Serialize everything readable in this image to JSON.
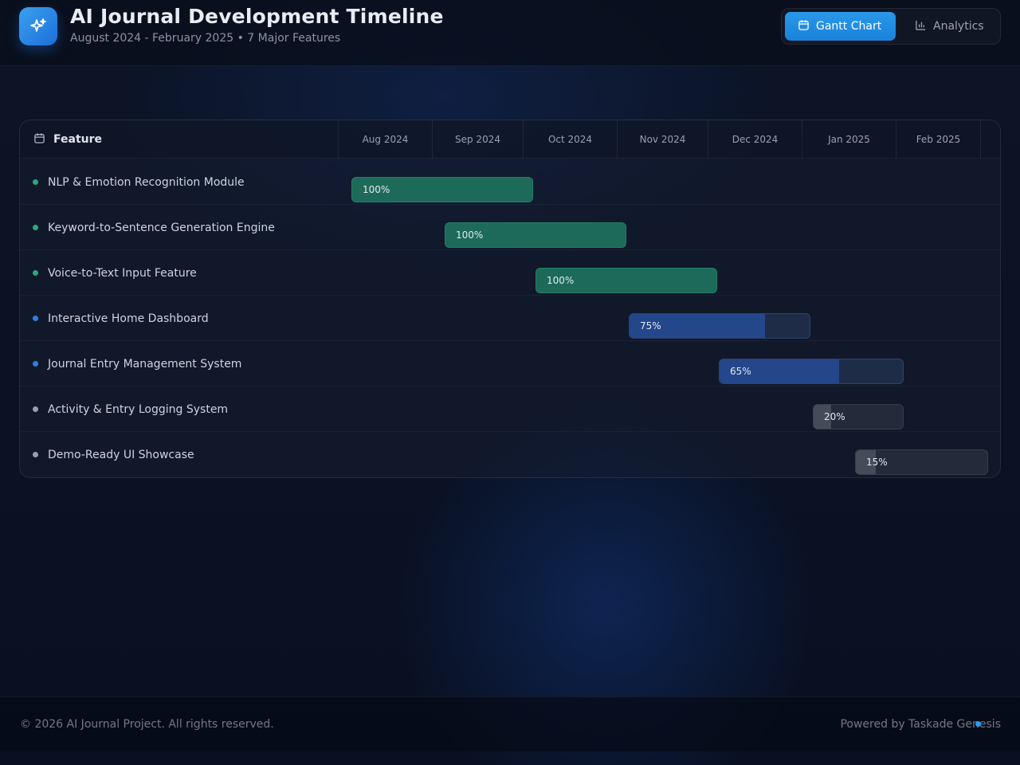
{
  "header": {
    "title": "AI Journal Development Timeline",
    "subtitle": "August 2024 - February 2025 • 7 Major Features",
    "views": [
      {
        "label": "Gantt Chart",
        "icon": "calendar-icon",
        "active": true
      },
      {
        "label": "Analytics",
        "icon": "bar-chart-icon",
        "active": false
      }
    ]
  },
  "gantt": {
    "feature_header": "Feature",
    "months": [
      "Aug 2024",
      "Sep 2024",
      "Oct 2024",
      "Nov 2024",
      "Dec 2024",
      "Jan 2025",
      "Feb 2025"
    ],
    "features": [
      {
        "name": "NLP & Emotion Recognition Module",
        "progress": 100,
        "progress_label": "100%",
        "status": "done"
      },
      {
        "name": "Keyword-to-Sentence Generation Engine",
        "progress": 100,
        "progress_label": "100%",
        "status": "done"
      },
      {
        "name": "Voice-to-Text Input Feature",
        "progress": 100,
        "progress_label": "100%",
        "status": "done"
      },
      {
        "name": "Interactive Home Dashboard",
        "progress": 75,
        "progress_label": "75%",
        "status": "progress"
      },
      {
        "name": "Journal Entry Management System",
        "progress": 65,
        "progress_label": "65%",
        "status": "progress"
      },
      {
        "name": "Activity & Entry Logging System",
        "progress": 20,
        "progress_label": "20%",
        "status": "planned"
      },
      {
        "name": "Demo-Ready UI Showcase",
        "progress": 15,
        "progress_label": "15%",
        "status": "planned"
      }
    ],
    "status_colors": {
      "done": "#2fa67f",
      "progress": "#2f7fe0",
      "planned": "#9aa0ab"
    }
  },
  "footer": {
    "copyright": "© 2026 AI Journal Project. All rights reserved.",
    "powered_by": "Powered by Taskade Genesis"
  }
}
